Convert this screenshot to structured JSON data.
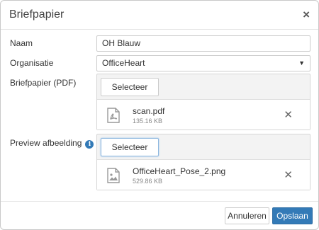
{
  "dialog": {
    "title": "Briefpapier",
    "close_icon": "close-icon"
  },
  "form": {
    "naam": {
      "label": "Naam",
      "value": "OH Blauw"
    },
    "organisatie": {
      "label": "Organisatie",
      "value": "OfficeHeart",
      "arrow": "▼"
    },
    "briefpapier": {
      "label": "Briefpapier (PDF)",
      "select_label": "Selecteer",
      "file": {
        "name": "scan.pdf",
        "size": "135.16 KB",
        "icon": "pdf-file-icon"
      }
    },
    "preview": {
      "label": "Preview afbeelding",
      "info": "i",
      "select_label": "Selecteer",
      "file": {
        "name": "OfficeHeart_Pose_2.png",
        "size": "529.86 KB",
        "icon": "image-file-icon"
      }
    }
  },
  "footer": {
    "cancel_label": "Annuleren",
    "save_label": "Opslaan"
  },
  "colors": {
    "primary": "#337ab7",
    "info": "#337ab7"
  }
}
